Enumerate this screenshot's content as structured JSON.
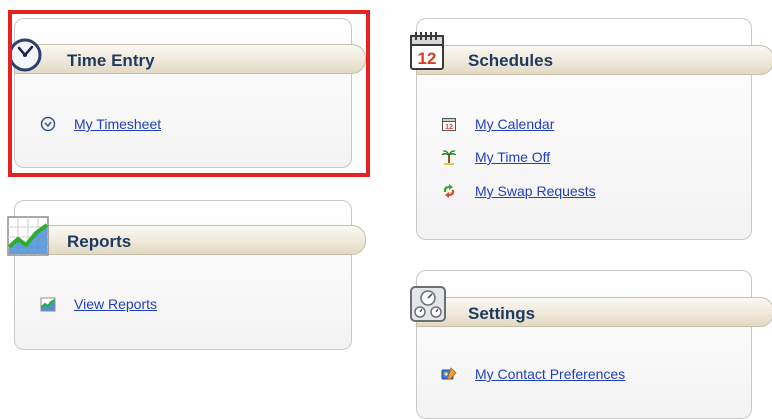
{
  "panels": {
    "time_entry": {
      "title": "Time Entry",
      "links": [
        {
          "label": "My Timesheet",
          "icon": "clock-icon"
        }
      ]
    },
    "schedules": {
      "title": "Schedules",
      "links": [
        {
          "label": "My Calendar",
          "icon": "calendar-icon"
        },
        {
          "label": "My Time Off",
          "icon": "palm-tree-icon"
        },
        {
          "label": "My Swap Requests",
          "icon": "swap-icon"
        }
      ]
    },
    "reports": {
      "title": "Reports",
      "links": [
        {
          "label": "View Reports",
          "icon": "chart-icon"
        }
      ]
    },
    "settings": {
      "title": "Settings",
      "links": [
        {
          "label": "My Contact Preferences",
          "icon": "contact-preferences-icon"
        }
      ]
    }
  },
  "calendar_icon_day": "12",
  "colors": {
    "highlight": "#e52222",
    "link": "#1f3fbf",
    "title": "#1f3a5f"
  }
}
